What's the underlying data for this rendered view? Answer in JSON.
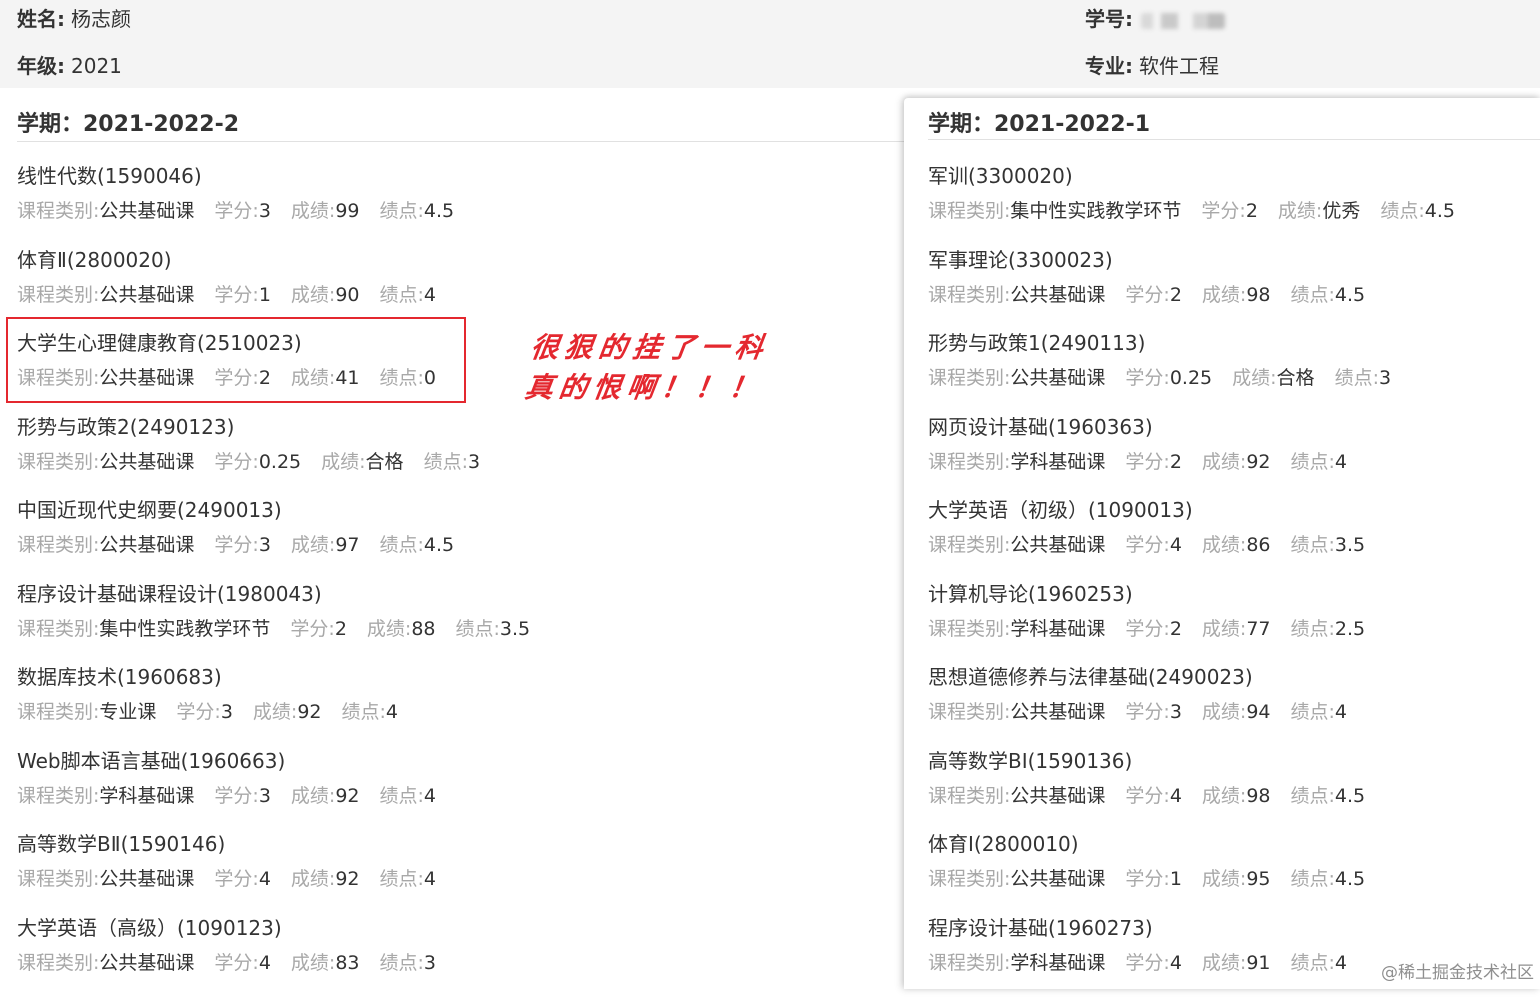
{
  "student": {
    "name_label": "姓名:",
    "name_value": "杨志颜",
    "grade_label": "年级:",
    "grade_value": "2021",
    "id_label": "学号:",
    "major_label": "专业:",
    "major_value": "软件工程"
  },
  "course_field_labels": {
    "type": "课程类别:",
    "credit": "学分:",
    "score": "成绩:",
    "gpa": "绩点:"
  },
  "semesters": [
    {
      "title": "学期：2021-2022-2",
      "courses": [
        {
          "name": "线性代数(1590046)",
          "type": "公共基础课",
          "credit": "3",
          "score": "99",
          "gpa": "4.5"
        },
        {
          "name": "体育Ⅱ(2800020)",
          "type": "公共基础课",
          "credit": "1",
          "score": "90",
          "gpa": "4"
        },
        {
          "name": "大学生心理健康教育(2510023)",
          "type": "公共基础课",
          "credit": "2",
          "score": "41",
          "gpa": "0"
        },
        {
          "name": "形势与政策2(2490123)",
          "type": "公共基础课",
          "credit": "0.25",
          "score": "合格",
          "gpa": "3"
        },
        {
          "name": "中国近现代史纲要(2490013)",
          "type": "公共基础课",
          "credit": "3",
          "score": "97",
          "gpa": "4.5"
        },
        {
          "name": "程序设计基础课程设计(1980043)",
          "type": "集中性实践教学环节",
          "credit": "2",
          "score": "88",
          "gpa": "3.5"
        },
        {
          "name": "数据库技术(1960683)",
          "type": "专业课",
          "credit": "3",
          "score": "92",
          "gpa": "4"
        },
        {
          "name": "Web脚本语言基础(1960663)",
          "type": "学科基础课",
          "credit": "3",
          "score": "92",
          "gpa": "4"
        },
        {
          "name": "高等数学BⅡ(1590146)",
          "type": "公共基础课",
          "credit": "4",
          "score": "92",
          "gpa": "4"
        },
        {
          "name": "大学英语（高级）(1090123)",
          "type": "公共基础课",
          "credit": "4",
          "score": "83",
          "gpa": "3"
        }
      ]
    },
    {
      "title": "学期：2021-2022-1",
      "courses": [
        {
          "name": "军训(3300020)",
          "type": "集中性实践教学环节",
          "credit": "2",
          "score": "优秀",
          "gpa": "4.5"
        },
        {
          "name": "军事理论(3300023)",
          "type": "公共基础课",
          "credit": "2",
          "score": "98",
          "gpa": "4.5"
        },
        {
          "name": "形势与政策1(2490113)",
          "type": "公共基础课",
          "credit": "0.25",
          "score": "合格",
          "gpa": "3"
        },
        {
          "name": "网页设计基础(1960363)",
          "type": "学科基础课",
          "credit": "2",
          "score": "92",
          "gpa": "4"
        },
        {
          "name": "大学英语（初级）(1090013)",
          "type": "公共基础课",
          "credit": "4",
          "score": "86",
          "gpa": "3.5"
        },
        {
          "name": "计算机导论(1960253)",
          "type": "学科基础课",
          "credit": "2",
          "score": "77",
          "gpa": "2.5"
        },
        {
          "name": "思想道德修养与法律基础(2490023)",
          "type": "公共基础课",
          "credit": "3",
          "score": "94",
          "gpa": "4"
        },
        {
          "name": "高等数学BⅠ(1590136)",
          "type": "公共基础课",
          "credit": "4",
          "score": "98",
          "gpa": "4.5"
        },
        {
          "name": "体育Ⅰ(2800010)",
          "type": "公共基础课",
          "credit": "1",
          "score": "95",
          "gpa": "4.5"
        },
        {
          "name": "程序设计基础(1960273)",
          "type": "学科基础课",
          "credit": "4",
          "score": "91",
          "gpa": "4"
        }
      ]
    }
  ],
  "annotation": {
    "line1": "很狠的挂了一科",
    "line2": "真的恨啊！！！",
    "color": "#e4282f"
  },
  "watermark": "@稀土掘金技术社区"
}
